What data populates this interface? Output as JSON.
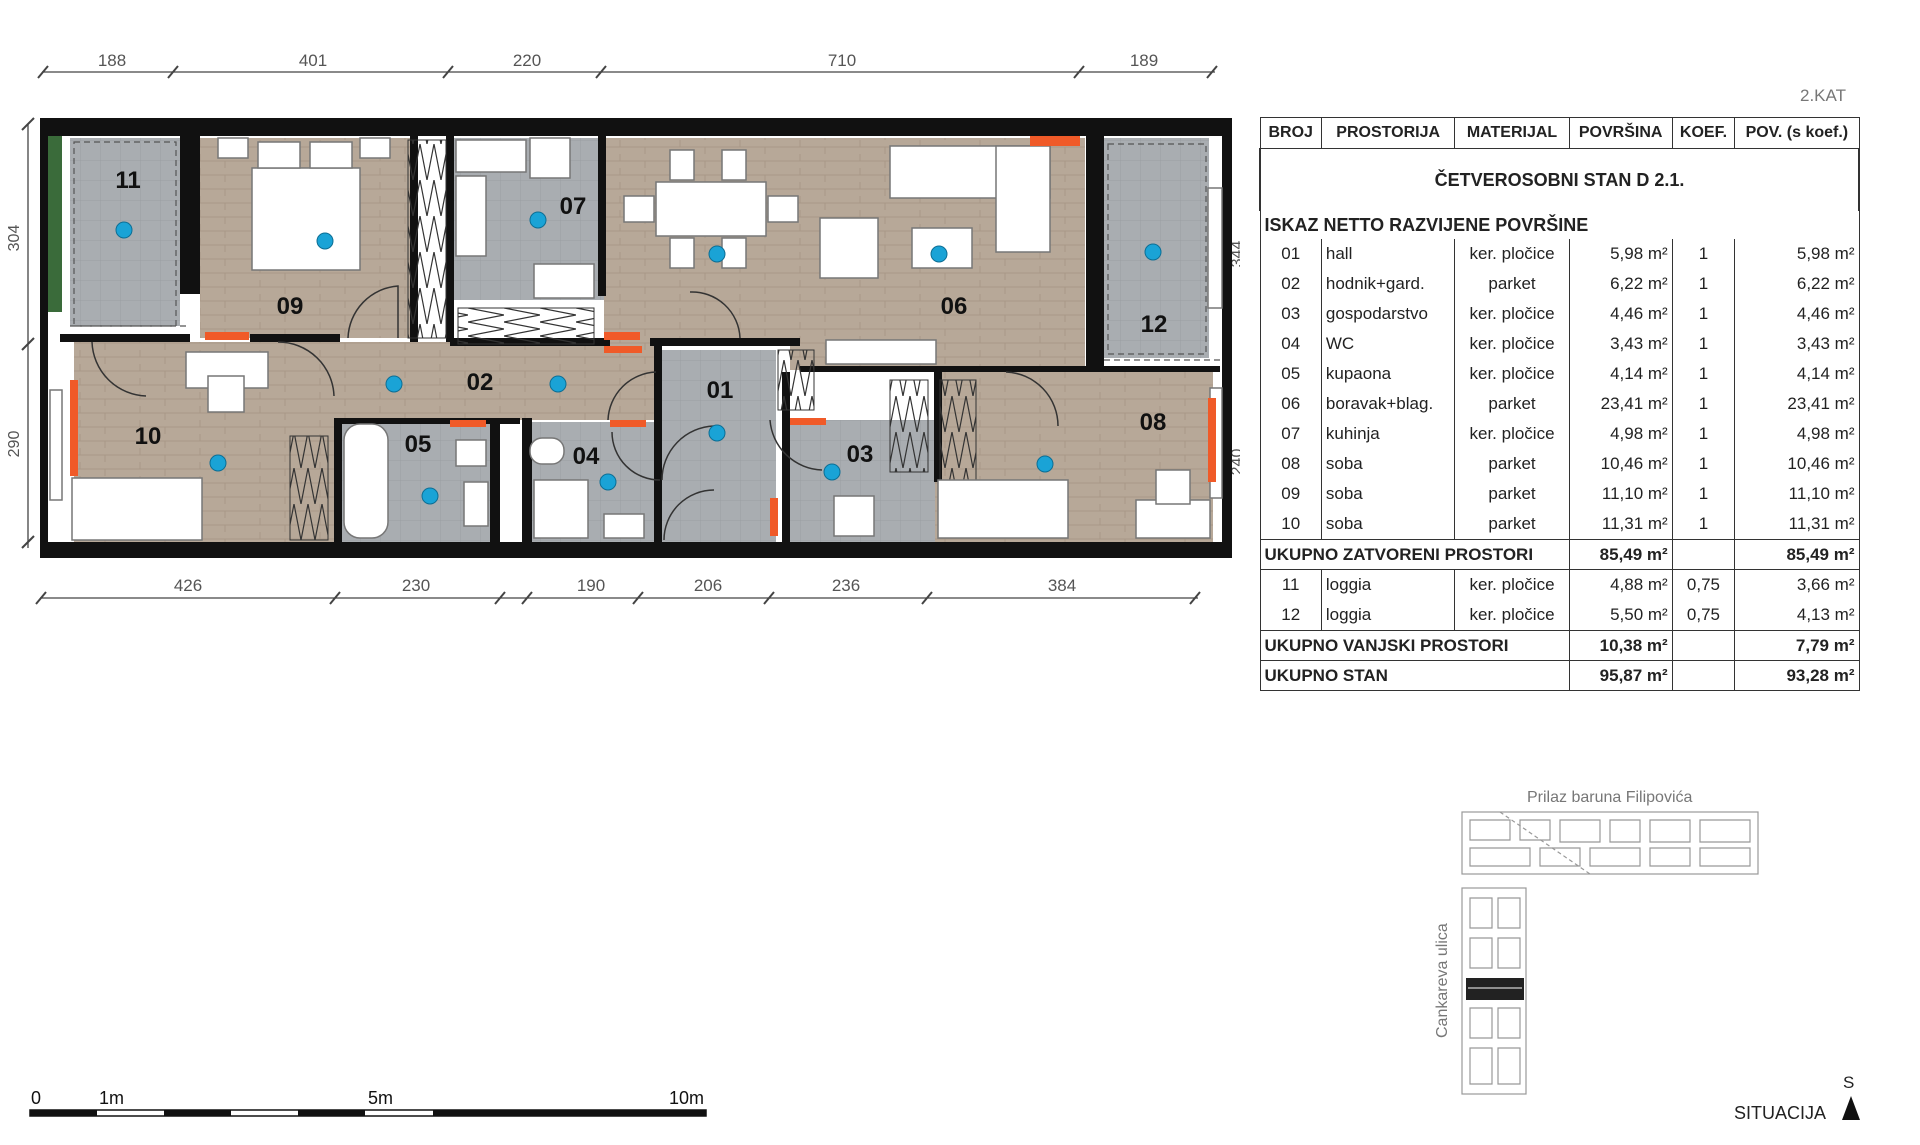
{
  "floor_label": "2.KAT",
  "apartment_title": "ČETVEROSOBNI STAN D 2.1.",
  "table_subtitle": "ISKAZ NETTO RAZVIJENE POVRŠINE",
  "columns": [
    "BROJ",
    "PROSTORIJA",
    "MATERIJAL",
    "POVRŠINA",
    "KOEF.",
    "POV. (s koef.)"
  ],
  "rooms_closed": [
    {
      "no": "01",
      "name": "hall",
      "material": "ker. pločice",
      "area": "5,98 m²",
      "coef": "1",
      "area_coef": "5,98 m²"
    },
    {
      "no": "02",
      "name": "hodnik+gard.",
      "material": "parket",
      "area": "6,22 m²",
      "coef": "1",
      "area_coef": "6,22 m²"
    },
    {
      "no": "03",
      "name": "gospodarstvo",
      "material": "ker. pločice",
      "area": "4,46 m²",
      "coef": "1",
      "area_coef": "4,46 m²"
    },
    {
      "no": "04",
      "name": "WC",
      "material": "ker. pločice",
      "area": "3,43 m²",
      "coef": "1",
      "area_coef": "3,43 m²"
    },
    {
      "no": "05",
      "name": "kupaona",
      "material": "ker. pločice",
      "area": "4,14 m²",
      "coef": "1",
      "area_coef": "4,14 m²"
    },
    {
      "no": "06",
      "name": "boravak+blag.",
      "material": "parket",
      "area": "23,41 m²",
      "coef": "1",
      "area_coef": "23,41 m²"
    },
    {
      "no": "07",
      "name": "kuhinja",
      "material": "ker. pločice",
      "area": "4,98 m²",
      "coef": "1",
      "area_coef": "4,98 m²"
    },
    {
      "no": "08",
      "name": "soba",
      "material": "parket",
      "area": "10,46 m²",
      "coef": "1",
      "area_coef": "10,46 m²"
    },
    {
      "no": "09",
      "name": "soba",
      "material": "parket",
      "area": "11,10 m²",
      "coef": "1",
      "area_coef": "11,10 m²"
    },
    {
      "no": "10",
      "name": "soba",
      "material": "parket",
      "area": "11,31 m²",
      "coef": "1",
      "area_coef": "11,31 m²"
    }
  ],
  "total_closed": {
    "label": "UKUPNO ZATVORENI PROSTORI",
    "area": "85,49 m²",
    "area_coef": "85,49 m²"
  },
  "rooms_open": [
    {
      "no": "11",
      "name": "loggia",
      "material": "ker. pločice",
      "area": "4,88 m²",
      "coef": "0,75",
      "area_coef": "3,66 m²"
    },
    {
      "no": "12",
      "name": "loggia",
      "material": "ker. pločice",
      "area": "5,50 m²",
      "coef": "0,75",
      "area_coef": "4,13 m²"
    }
  ],
  "total_open": {
    "label": "UKUPNO VANJSKI PROSTORI",
    "area": "10,38 m²",
    "area_coef": "7,79 m²"
  },
  "total_all": {
    "label": "UKUPNO STAN",
    "area": "95,87 m²",
    "area_coef": "93,28 m²"
  },
  "dims_top": [
    "188",
    "401",
    "220",
    "710",
    "189"
  ],
  "dims_bottom": [
    "426",
    "230",
    "190",
    "206",
    "236",
    "384"
  ],
  "dims_left": [
    "304",
    "290"
  ],
  "dims_right": [
    "344",
    "240"
  ],
  "room_labels": [
    "01",
    "02",
    "03",
    "04",
    "05",
    "06",
    "07",
    "08",
    "09",
    "10",
    "11",
    "12"
  ],
  "scale_labels": [
    "0",
    "1m",
    "5m",
    "10m"
  ],
  "situation": {
    "street_top": "Prilaz baruna Filipovića",
    "street_left": "Cankareva ulica",
    "label": "SITUACIJA",
    "north": "S"
  },
  "colors": {
    "wall": "#111111",
    "parquet": "#b5a696",
    "tile": "#a9adb0",
    "door_accent": "#f05a28",
    "light_point": "#1aa3d6",
    "green_wall": "#3a6b3a"
  }
}
